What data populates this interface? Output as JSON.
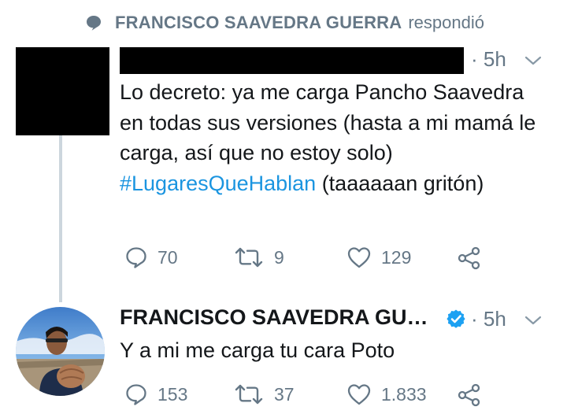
{
  "context": {
    "icon": "reply-bubble-icon",
    "name": "FRANCISCO SAAVEDRA GUERRA",
    "verb": "respondió"
  },
  "tweet1": {
    "time": "· 5h",
    "body_text": "Lo decreto: ya me carga Pancho Saavedra en todas sus versiones (hasta a mi mamá le carga, así que no estoy solo) ",
    "hashtag": "#LugaresQueHablan",
    "body_tail": " (taaaaaan gritón)",
    "replies": "70",
    "retweets": "9",
    "likes": "129"
  },
  "tweet2": {
    "name": "FRANCISCO SAAVEDRA GU…",
    "time": "· 5h",
    "body": "Y a mi me carga tu cara Poto",
    "replies": "153",
    "retweets": "37",
    "likes": "1.833"
  },
  "colors": {
    "muted": "#657786",
    "link": "#1b95e0",
    "verified": "#1da1f2",
    "thread": "#ccd6dd"
  }
}
